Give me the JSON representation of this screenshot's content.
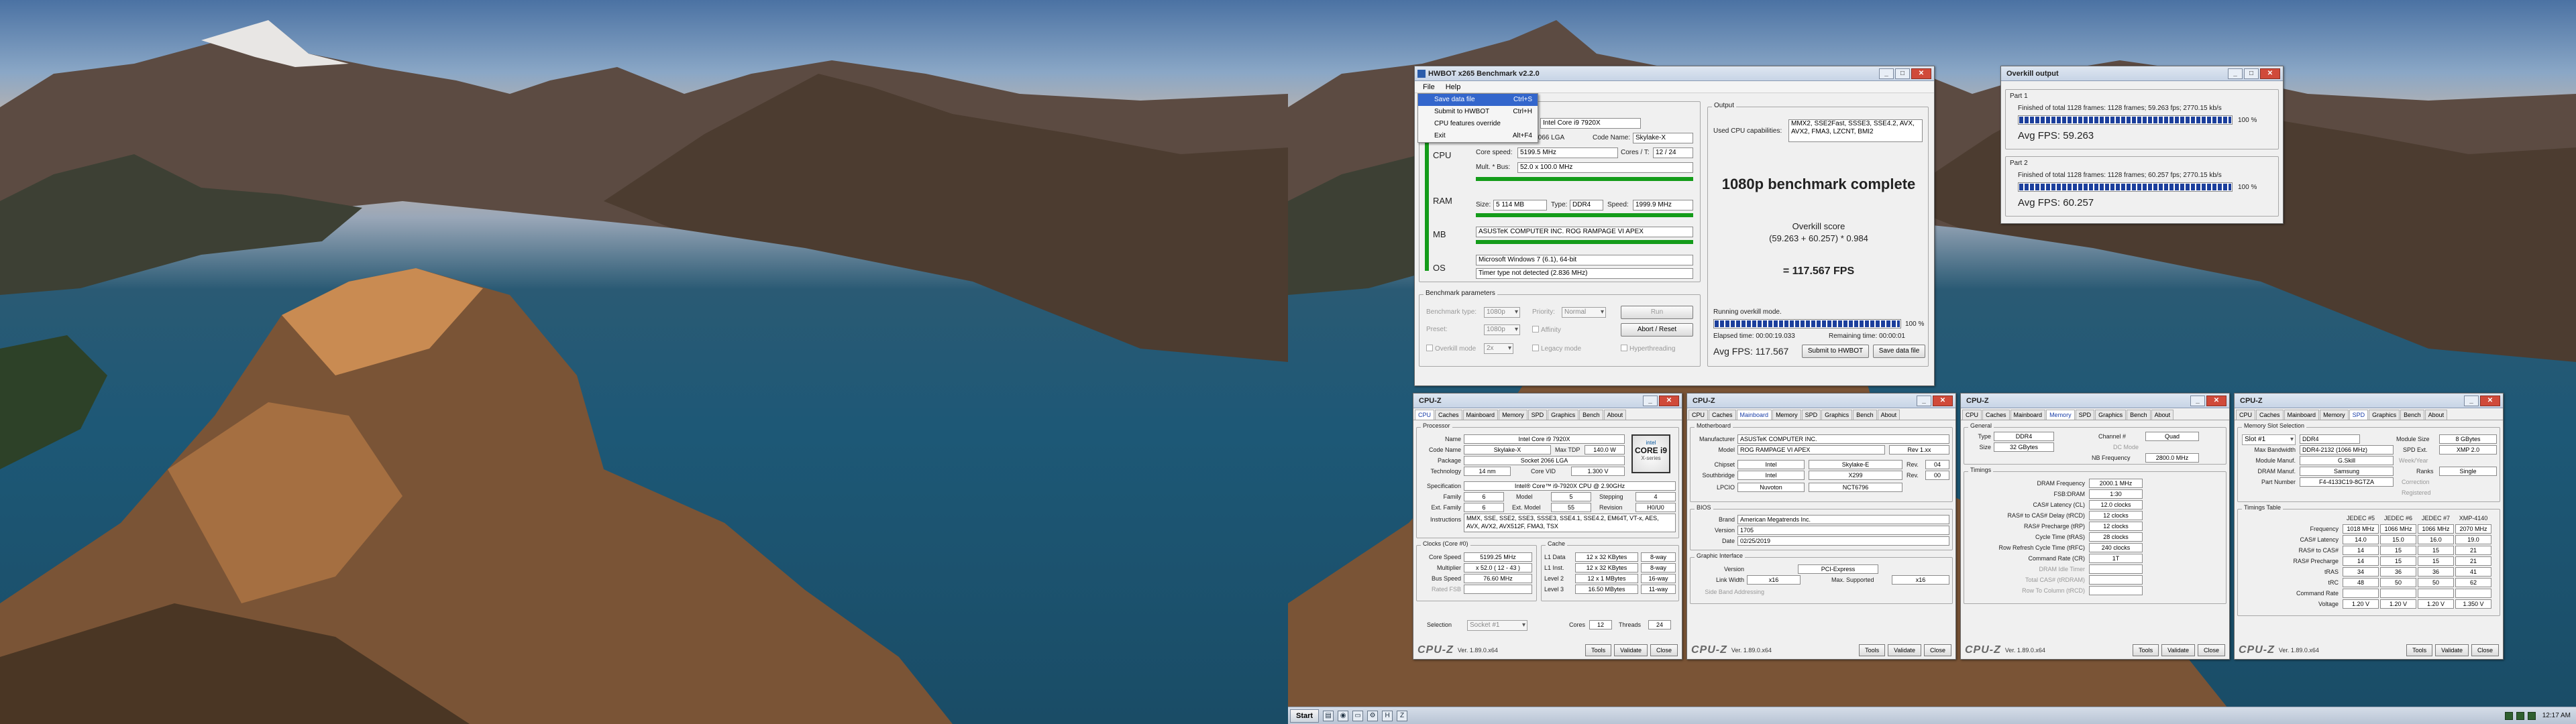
{
  "colors": {
    "accent": "#1c3f9c",
    "green_bar": "#149c1a",
    "title_bar": "#c7d4e6",
    "close_btn": "#d04a3a"
  },
  "hwbot": {
    "title": "HWBOT x265 Benchmark v2.2.0",
    "menu": [
      "File",
      "Help"
    ],
    "file_menu": [
      {
        "label": "Save data file",
        "shortcut": "Ctrl+S"
      },
      {
        "label": "Submit to HWBOT",
        "shortcut": "Ctrl+H"
      },
      {
        "label": "CPU features override",
        "shortcut": ""
      },
      {
        "label": "Exit",
        "shortcut": "Alt+F4"
      }
    ],
    "system": {
      "cpu_name": "Intel Core i9 7920X",
      "socket_partial": "et 2066 LGA",
      "code_name_label": "Code Name:",
      "code_name": "Skylake-X",
      "core_speed_label": "Core speed:",
      "core_speed": "5199.5 MHz",
      "cores_t_label": "Cores / T:",
      "cores_t": "12 / 24",
      "mult_label": "Mult. * Bus:",
      "mult": "52.0 x 100.0 MHz",
      "size_label": "Size:",
      "ram_size": "5 114 MB",
      "type_label": "Type:",
      "ram_type": "DDR4",
      "speed_label": "Speed:",
      "ram_speed": "1999.9 MHz",
      "mb": "ASUSTeK COMPUTER INC. ROG RAMPAGE VI APEX",
      "os": "Microsoft Windows 7 (6.1), 64-bit",
      "timer": "Timer type not detected (2.836 MHz)",
      "side_labels": [
        "CPU",
        "RAM",
        "MB",
        "OS"
      ]
    },
    "params": {
      "group_label": "Benchmark parameters",
      "bench_type_label": "Benchmark type:",
      "bench_type": "1080p",
      "priority_label": "Priority:",
      "priority": "Normal",
      "preset_label": "Preset:",
      "preset": "1080p",
      "run_label": "Run",
      "abort_label": "Abort / Reset",
      "overkill_label": "Overkill mode",
      "overkill_val": "2x",
      "legacy_label": "Legacy mode",
      "affinity_label": "Affinity",
      "hyper_label": "Hyperthreading"
    },
    "output": {
      "group_label": "Output",
      "cpu_cap_label": "Used CPU capabilities:",
      "cpu_caps": "MMX2, SSE2Fast, SSSE3, SSE4.2, AVX, AVX2, FMA3, LZCNT, BMI2",
      "headline": "1080p benchmark complete",
      "score_title": "Overkill score",
      "score_formula": "(59.263 + 60.257) * 0.984",
      "score_result": "= 117.567 FPS",
      "status": "Running overkill mode.",
      "progress_pct": 100,
      "progress_label": "100 %",
      "elapsed": "Elapsed time: 00:00:19.033",
      "remaining": "Remaining time: 00:00:01",
      "avg_fps": "Avg FPS: 117.567",
      "submit_label": "Submit to HWBOT",
      "save_label": "Save data file"
    }
  },
  "overkill": {
    "title": "Overkill output",
    "parts": [
      {
        "name": "Part 1",
        "finished": "Finished of total 1128 frames: 1128 frames; 59.263 fps; 2770.15 kb/s",
        "pct": 100,
        "pct_label": "100 %",
        "avg": "Avg FPS: 59.263"
      },
      {
        "name": "Part 2",
        "finished": "Finished of total 1128 frames: 1128 frames; 60.257 fps; 2770.15 kb/s",
        "pct": 100,
        "pct_label": "100 %",
        "avg": "Avg FPS: 60.257"
      }
    ]
  },
  "cpuz_common": {
    "title": "CPU-Z",
    "tabs": [
      "CPU",
      "Caches",
      "Mainboard",
      "Memory",
      "SPD",
      "Graphics",
      "Bench",
      "About"
    ],
    "logo": "CPU-Z",
    "version": "Ver. 1.89.0.x64",
    "tools": "Tools",
    "validate": "Validate",
    "close": "Close"
  },
  "cpuz_cpu": {
    "processor": "Processor",
    "name_l": "Name",
    "name": "Intel Core i9 7920X",
    "code_l": "Code Name",
    "code": "Skylake-X",
    "tdp_l": "Max TDP",
    "tdp": "140.0 W",
    "pkg_l": "Package",
    "pkg": "Socket 2066 LGA",
    "tech_l": "Technology",
    "tech": "14 nm",
    "volt_l": "Core VID",
    "volt": "1.300 V",
    "spec_l": "Specification",
    "spec": "Intel® Core™ i9-7920X CPU @ 2.90GHz",
    "fam_l": "Family",
    "fam": "6",
    "model_l": "Model",
    "model": "5",
    "step_l": "Stepping",
    "step": "4",
    "extfam_l": "Ext. Family",
    "extfam": "6",
    "extmod_l": "Ext. Model",
    "extmod": "55",
    "rev_l": "Revision",
    "rev": "H0/U0",
    "instr_l": "Instructions",
    "instr": "MMX, SSE, SSE2, SSE3, SSSE3, SSE4.1, SSE4.2, EM64T, VT-x, AES, AVX, AVX2, AVX512F, FMA3, TSX",
    "clocks": "Clocks (Core #0)",
    "cs_l": "Core Speed",
    "cs": "5199.25 MHz",
    "mu_l": "Multiplier",
    "mu": "x 52.0 ( 12 - 43 )",
    "bs_l": "Bus Speed",
    "bs": "76.60 MHz",
    "rf_l": "Rated FSB",
    "cache": "Cache",
    "l1d_l": "L1 Data",
    "l1d": "12 x 32 KBytes",
    "l1d_w": "8-way",
    "l1i_l": "L1 Inst.",
    "l1i": "12 x 32 KBytes",
    "l1i_w": "8-way",
    "l2_l": "Level 2",
    "l2": "12 x 1 MBytes",
    "l2_w": "16-way",
    "l3_l": "Level 3",
    "l3": "16.50 MBytes",
    "l3_w": "11-way",
    "selection_l": "Selection",
    "selection": "Socket #1",
    "cores_l": "Cores",
    "cores": "12",
    "threads_l": "Threads",
    "threads": "24",
    "badge": {
      "a": "intel",
      "b": "CORE i9",
      "c": "X-series"
    }
  },
  "cpuz_mb": {
    "mb": "Motherboard",
    "man_l": "Manufacturer",
    "man": "ASUSTeK COMPUTER INC.",
    "model_l": "Model",
    "model": "ROG RAMPAGE VI APEX",
    "model_rev": "Rev 1.xx",
    "chip_l": "Chipset",
    "chip": "Intel",
    "chip2": "Skylake-E",
    "chip_rev_l": "Rev.",
    "chip_rev": "04",
    "sb_l": "Southbridge",
    "sb": "Intel",
    "sb2": "X299",
    "sb_rev_l": "Rev.",
    "sb_rev": "00",
    "lpc_l": "LPCIO",
    "lpc": "Nuvoton",
    "lpc2": "NCT6796",
    "bios": "BIOS",
    "brand_l": "Brand",
    "brand": "American Megatrends Inc.",
    "ver_l": "Version",
    "ver": "1705",
    "date_l": "Date",
    "date": "02/25/2019",
    "gi": "Graphic Interface",
    "giv_l": "Version",
    "giv": "PCI-Express",
    "lw_l": "Link Width",
    "lw": "x16",
    "ms_l": "Max. Supported",
    "ms": "x16",
    "sba_l": "Side Band Addressing"
  },
  "cpuz_mem": {
    "general": "General",
    "type_l": "Type",
    "type": "DDR4",
    "ch_l": "Channel #",
    "ch": "Quad",
    "size_l": "Size",
    "size": "32 GBytes",
    "dc_l": "DC Mode",
    "nb_l": "NB Frequency",
    "nb": "2800.0 MHz",
    "timings": "Timings",
    "rows": [
      {
        "l": "DRAM Frequency",
        "v": "2000.1 MHz"
      },
      {
        "l": "FSB:DRAM",
        "v": "1:30"
      },
      {
        "l": "CAS# Latency (CL)",
        "v": "12.0 clocks"
      },
      {
        "l": "RAS# to CAS# Delay (tRCD)",
        "v": "12 clocks"
      },
      {
        "l": "RAS# Precharge (tRP)",
        "v": "12 clocks"
      },
      {
        "l": "Cycle Time (tRAS)",
        "v": "28 clocks"
      },
      {
        "l": "Row Refresh Cycle Time (tRFC)",
        "v": "240 clocks"
      },
      {
        "l": "Command Rate (CR)",
        "v": "1T"
      },
      {
        "l": "DRAM Idle Timer",
        "v": ""
      },
      {
        "l": "Total CAS# (tRDRAM)",
        "v": ""
      },
      {
        "l": "Row To Column (tRCD)",
        "v": ""
      }
    ]
  },
  "cpuz_spd": {
    "mss": "Memory Slot Selection",
    "slot": "Slot #1",
    "slot_type": "DDR4",
    "msize_l": "Module Size",
    "msize": "8 GBytes",
    "mbw_l": "Max Bandwidth",
    "mbw": "DDR4-2132 (1066 MHz)",
    "spdext_l": "SPD Ext.",
    "spdext": "XMP 2.0",
    "mman_l": "Module Manuf.",
    "mman": "G.Skill",
    "wk_l": "Week/Year",
    "dman_l": "DRAM Manuf.",
    "dman": "Samsung",
    "ranks_l": "Ranks",
    "ranks": "Single",
    "pn_l": "Part Number",
    "pn": "F4-4133C19-8GTZA",
    "corr_l": "Correction",
    "reg_l": "Registered",
    "tt": "Timings Table",
    "cols": [
      "JEDEC #5",
      "JEDEC #6",
      "JEDEC #7",
      "XMP-4140"
    ],
    "rows": [
      {
        "l": "Frequency",
        "v": [
          "1018 MHz",
          "1066 MHz",
          "1066 MHz",
          "2070 MHz"
        ]
      },
      {
        "l": "CAS# Latency",
        "v": [
          "14.0",
          "15.0",
          "16.0",
          "19.0"
        ]
      },
      {
        "l": "RAS# to CAS#",
        "v": [
          "14",
          "15",
          "15",
          "21"
        ]
      },
      {
        "l": "RAS# Precharge",
        "v": [
          "14",
          "15",
          "15",
          "21"
        ]
      },
      {
        "l": "tRAS",
        "v": [
          "34",
          "36",
          "36",
          "41"
        ]
      },
      {
        "l": "tRC",
        "v": [
          "48",
          "50",
          "50",
          "62"
        ]
      },
      {
        "l": "Command Rate",
        "v": [
          "",
          "",
          "",
          ""
        ]
      },
      {
        "l": "Voltage",
        "v": [
          "1.20 V",
          "1.20 V",
          "1.20 V",
          "1.350 V"
        ]
      }
    ]
  },
  "taskbar": {
    "start": "Start",
    "clock": "12:17 AM"
  }
}
